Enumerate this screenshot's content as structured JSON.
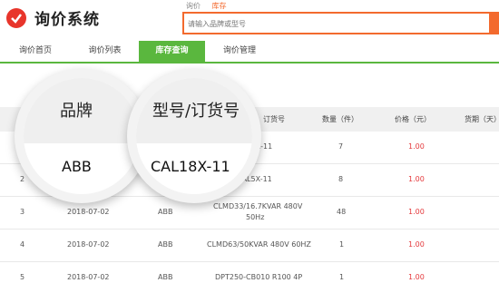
{
  "header": {
    "logo_text": "询价系统",
    "search_tabs": [
      "询价",
      "库存"
    ],
    "search_placeholder": "请输入品牌或型号"
  },
  "nav": {
    "items": [
      "询价首页",
      "询价列表",
      "库存查询",
      "询价管理"
    ],
    "active_index": 2
  },
  "table": {
    "headers": {
      "model": "订货号",
      "qty": "数量（件）",
      "price": "价格（元）",
      "lead": "货期（天）"
    },
    "rows": [
      {
        "no": "",
        "date": "",
        "brand": "",
        "model": "8X-11",
        "qty": "7",
        "price": "1.00"
      },
      {
        "no": "2",
        "date": "",
        "brand": "",
        "model": "CAL5X-11",
        "qty": "8",
        "price": "1.00"
      },
      {
        "no": "3",
        "date": "2018-07-02",
        "brand": "ABB",
        "model": "CLMD33/16.7KVAR 480V",
        "model2": "50Hz",
        "qty": "48",
        "price": "1.00"
      },
      {
        "no": "4",
        "date": "2018-07-02",
        "brand": "ABB",
        "model": "CLMD63/50KVAR 480V 60HZ",
        "qty": "1",
        "price": "1.00"
      },
      {
        "no": "5",
        "date": "2018-07-02",
        "brand": "ABB",
        "model": "DPT250-CB010 R100 4P",
        "qty": "1",
        "price": "1.00"
      }
    ]
  },
  "magnifier": {
    "brand_label": "品牌",
    "brand_value": "ABB",
    "model_label": "型号/订货号",
    "model_value": "CAL18X-11"
  },
  "colors": {
    "accent": "#f36a2e",
    "nav_active": "#5ab73e",
    "price": "#e4393c"
  }
}
